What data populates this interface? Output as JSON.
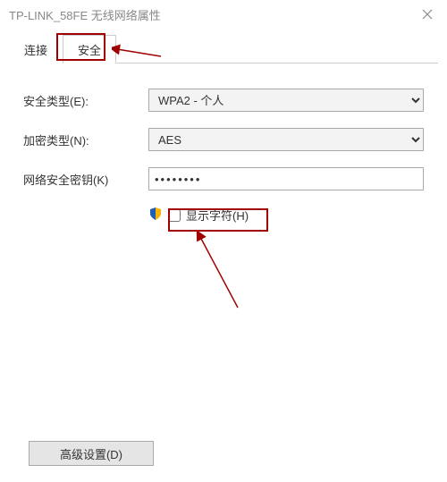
{
  "window": {
    "title": "TP-LINK_58FE 无线网络属性"
  },
  "tabs": {
    "connect": "连接",
    "security": "安全"
  },
  "form": {
    "security_type_label": "安全类型(E):",
    "security_type_value": "WPA2 - 个人",
    "encryption_label": "加密类型(N):",
    "encryption_value": "AES",
    "key_label": "网络安全密钥(K)",
    "key_value": "••••••••",
    "show_chars_label": "显示字符(H)"
  },
  "buttons": {
    "advanced": "高级设置(D)"
  }
}
